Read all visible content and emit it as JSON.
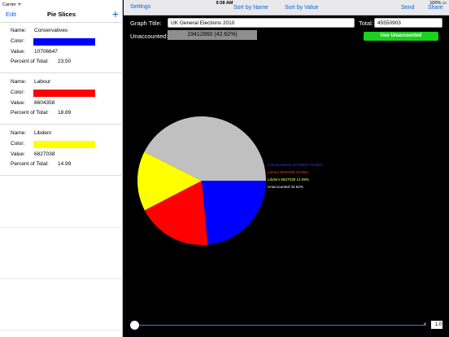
{
  "status": {
    "carrier": "Carrier ᯤ",
    "time": "9:58 AM",
    "battery": "100% ▭"
  },
  "left": {
    "edit_label": "Edit",
    "title": "Pie Slices",
    "add_label": "+",
    "labels": {
      "name": "Name:",
      "color": "Color:",
      "value": "Value:",
      "percent": "Percent of Total:"
    },
    "slices": [
      {
        "name": "Conservatives",
        "color": "#0000ff",
        "value": "10706647",
        "percent": "23.50"
      },
      {
        "name": "Labour",
        "color": "#ff0000",
        "value": "8604358",
        "percent": "18.89"
      },
      {
        "name": "Libdem",
        "color": "#ffff00",
        "value": "6827038",
        "percent": "14.99"
      }
    ]
  },
  "toolbar": {
    "settings": "Settings",
    "sort_by_name": "Sort by Name",
    "sort_by_value": "Sort by Value",
    "send": "Send",
    "share": "Share"
  },
  "form": {
    "graph_title_label": "Graph Title:",
    "graph_title_value": "UK General Elections 2010",
    "total_label": "Total:",
    "total_value": "45550903",
    "unaccounted_label": "Unaccounted:",
    "unaccounted_value": "19412860 (42.62%)",
    "use_unaccounted": "Use Unaccounted"
  },
  "chart_data": {
    "type": "pie",
    "slices": [
      {
        "label": "Conservatives",
        "value": 10706647,
        "percent": 23.5,
        "color": "#0000ff",
        "legend": "Conservatives 10706647 23.50%"
      },
      {
        "label": "Labour",
        "value": 8604358,
        "percent": 18.89,
        "color": "#ff0000",
        "legend": "Labour 8604358 18.89%"
      },
      {
        "label": "Libdem",
        "value": 6827038,
        "percent": 14.99,
        "color": "#ffff00",
        "legend": "Libdem 6827038 14.99%"
      },
      {
        "label": "Unaccounted",
        "value": 19412860,
        "percent": 42.62,
        "color": "#c0c0c0",
        "legend": "Unaccounted 42.62%"
      }
    ],
    "legend_colors": [
      "#3a3aff",
      "#ff3030",
      "#ffff40",
      "#ffffff"
    ]
  },
  "scale": {
    "x_label": "x",
    "value": "1.0"
  }
}
